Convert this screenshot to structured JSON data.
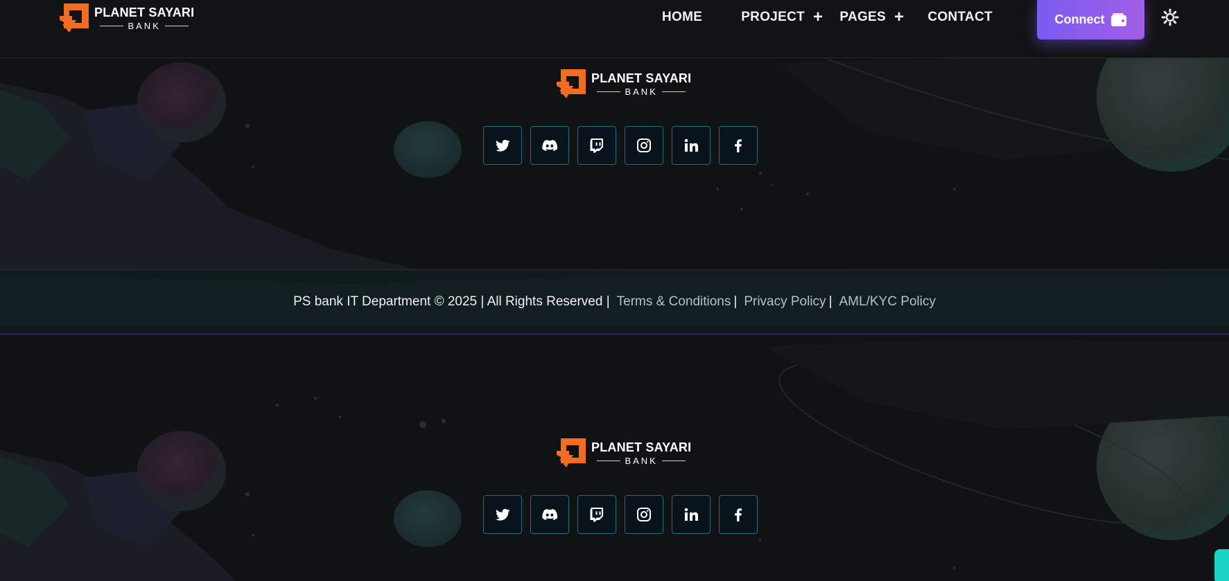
{
  "brand": {
    "name": "PLANET SAYARI",
    "sub": "BANK",
    "accent": "#f26d21"
  },
  "nav": {
    "items": [
      {
        "label": "HOME",
        "has_sub": false
      },
      {
        "label": "PROJECT",
        "has_sub": true
      },
      {
        "label": "PAGES",
        "has_sub": true
      },
      {
        "label": "CONTACT",
        "has_sub": false
      }
    ],
    "plus": "+",
    "connect_label": "Connect",
    "connect_icon": "wallet-icon",
    "settings_icon": "gear-icon"
  },
  "social": {
    "icons": [
      "twitter-icon",
      "discord-icon",
      "twitch-icon",
      "instagram-icon",
      "linkedin-icon",
      "facebook-icon"
    ],
    "border_color": "#1f6f80"
  },
  "footer": {
    "copyright": "PS bank IT Department © 2025 | All Rights Reserved |",
    "links": [
      {
        "label": "Terms & Conditions"
      },
      {
        "label": "Privacy Policy"
      },
      {
        "label": "AML/KYC Policy"
      }
    ],
    "link_sep": "|"
  },
  "colors": {
    "background": "#111213",
    "connect_gradient_start": "#7b5cf0",
    "connect_gradient_end": "#a15ee6",
    "chat_tab": "#19d3c5"
  }
}
